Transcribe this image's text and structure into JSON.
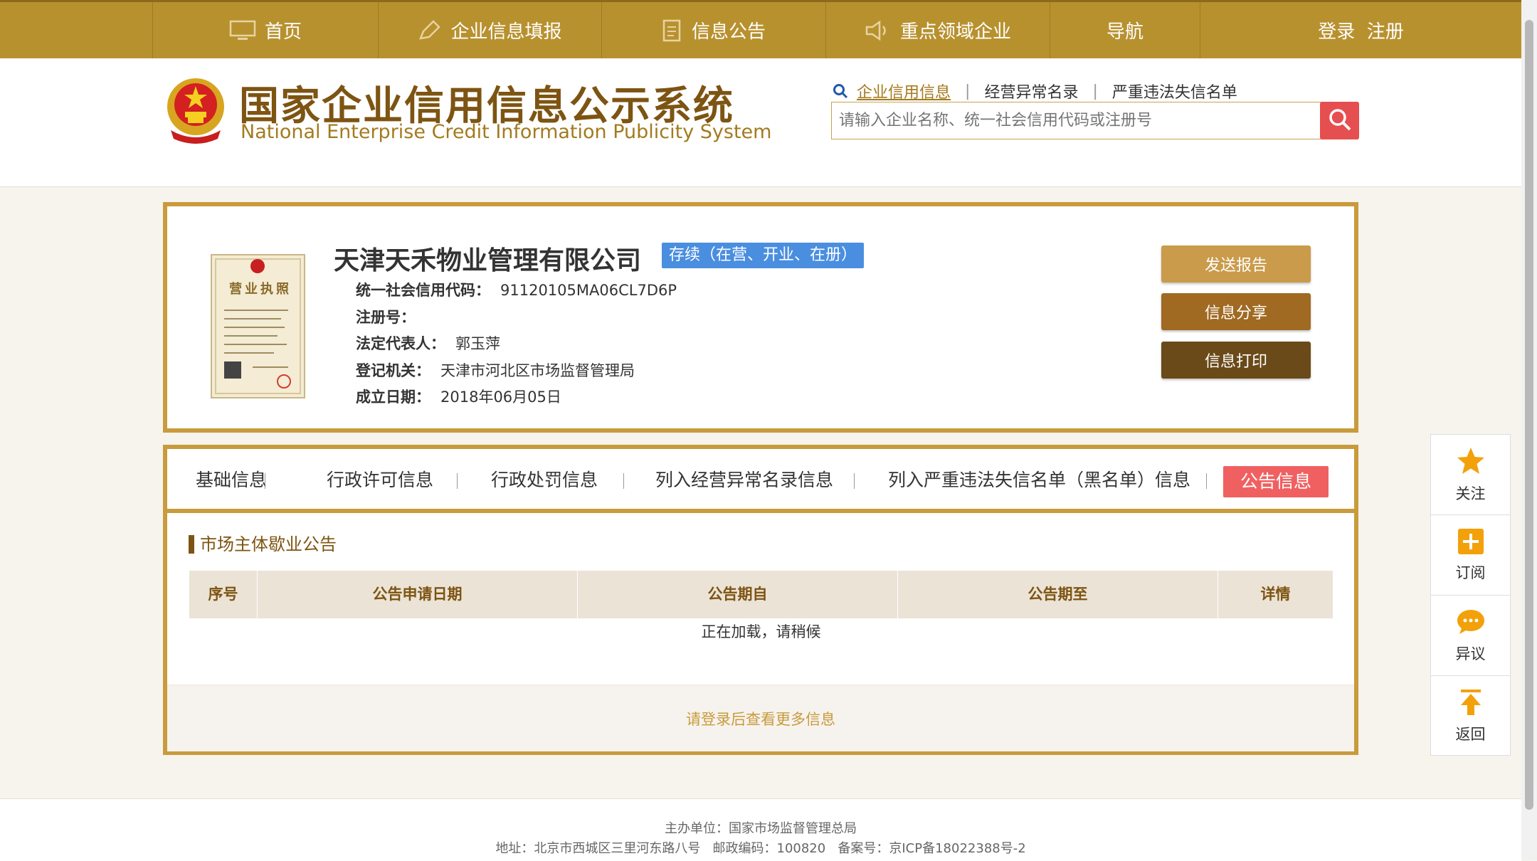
{
  "nav": {
    "items": [
      {
        "label": "首页",
        "icon": "monitor-icon"
      },
      {
        "label": "企业信息填报",
        "icon": "edit-icon"
      },
      {
        "label": "信息公告",
        "icon": "document-icon"
      },
      {
        "label": "重点领域企业",
        "icon": "speaker-icon"
      },
      {
        "label": "导航"
      },
      {
        "label": "登录  注册"
      }
    ]
  },
  "header": {
    "logo_cn": "国家企业信用信息公示系统",
    "logo_en": "National Enterprise Credit Information Publicity System",
    "search_tabs": [
      "企业信用信息",
      "经营异常名录",
      "严重违法失信名单"
    ],
    "search_placeholder": "请输入企业名称、统一社会信用代码或注册号"
  },
  "company": {
    "name": "天津天禾物业管理有限公司",
    "status": "存续（在营、开业、在册）",
    "license_label": "营业执照",
    "fields": [
      {
        "label": "统一社会信用代码：",
        "value": "91120105MA06CL7D6P"
      },
      {
        "label": "注册号：",
        "value": ""
      },
      {
        "label": "法定代表人：",
        "value": "郭玉萍"
      },
      {
        "label": "登记机关：",
        "value": "天津市河北区市场监督管理局"
      },
      {
        "label": "成立日期：",
        "value": "2018年06月05日"
      }
    ],
    "buttons": [
      "发送报告",
      "信息分享",
      "信息打印"
    ]
  },
  "tabs": [
    "基础信息",
    "行政许可信息",
    "行政处罚信息",
    "列入经营异常名录信息",
    "列入严重违法失信名单（黑名单）信息",
    "公告信息"
  ],
  "section": {
    "title": "市场主体歇业公告",
    "columns": [
      "序号",
      "公告申请日期",
      "公告期自",
      "公告期至",
      "详情"
    ],
    "loading": "正在加载，请稍候",
    "login_more": "请登录后查看更多信息"
  },
  "sidebar": [
    {
      "label": "关注",
      "icon": "star-icon"
    },
    {
      "label": "订阅",
      "icon": "plus-icon"
    },
    {
      "label": "异议",
      "icon": "chat-icon"
    },
    {
      "label": "返回",
      "icon": "arrow-up-icon"
    }
  ],
  "footer": {
    "line1": "主办单位：国家市场监督管理总局",
    "line2": "地址：北京市西城区三里河东路八号   邮政编码：100820   备案号：京ICP备18022388号-2"
  },
  "colors": {
    "brand": "#b8912f",
    "dark_brand": "#7d5412",
    "status": "#4a8ee0",
    "active_tab": "#f06060",
    "search_btn": "#e64f4f"
  }
}
